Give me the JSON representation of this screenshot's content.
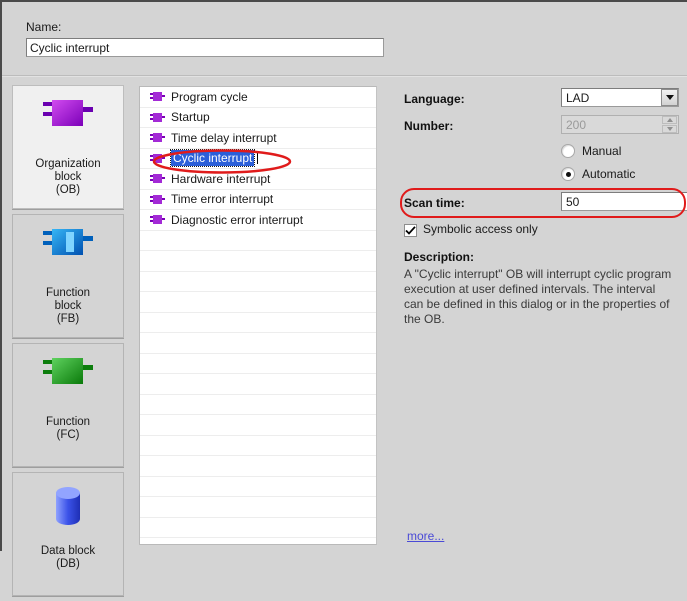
{
  "name_section": {
    "label": "Name:",
    "value": "Cyclic interrupt",
    "placeholder": "Name"
  },
  "block_types": [
    {
      "id": "ob",
      "line1": "Organization",
      "line2": "block",
      "line3": "(OB)",
      "icon": "organization-block-icon",
      "color": "#a020d0",
      "selected": true
    },
    {
      "id": "fb",
      "line1": "Function",
      "line2": "block",
      "line3": "(FB)",
      "icon": "function-block-icon",
      "color": "#1d86d8",
      "selected": false
    },
    {
      "id": "fc",
      "line1": "Function",
      "line2": "",
      "line3": "(FC)",
      "icon": "function-icon",
      "color": "#19a019",
      "selected": false
    },
    {
      "id": "db",
      "line1": "Data block",
      "line2": "",
      "line3": "(DB)",
      "icon": "data-block-icon",
      "color": "#3a4fe0",
      "selected": false
    }
  ],
  "ob_list": {
    "items": [
      {
        "label": "Program cycle",
        "selected": false
      },
      {
        "label": "Startup",
        "selected": false
      },
      {
        "label": "Time delay interrupt",
        "selected": false
      },
      {
        "label": "Cyclic interrupt",
        "selected": true
      },
      {
        "label": "Hardware interrupt",
        "selected": false
      },
      {
        "label": "Time error interrupt",
        "selected": false
      },
      {
        "label": "Diagnostic error interrupt",
        "selected": false
      }
    ],
    "empty_row_count": 15
  },
  "properties": {
    "language": {
      "label": "Language:",
      "value": "LAD"
    },
    "number": {
      "label": "Number:",
      "value": "200",
      "disabled": true
    },
    "numbering_mode": {
      "manual": {
        "label": "Manual",
        "selected": false
      },
      "automatic": {
        "label": "Automatic",
        "selected": true
      }
    },
    "scan_time": {
      "label": "Scan time:",
      "value": "50",
      "highlight_color": "#e01b1b"
    },
    "symbolic_access": {
      "label": "Symbolic access only",
      "checked": true
    },
    "description": {
      "title": "Description:",
      "text": "A \"Cyclic interrupt\" OB will interrupt cyclic program execution at user defined intervals. The interval can be defined in this dialog or in the properties of the OB."
    },
    "more_link": "more..."
  },
  "annotations": {
    "highlight_color": "#e01b1b",
    "selected_list_item": "Cyclic interrupt",
    "selected_field": "Scan time:"
  }
}
